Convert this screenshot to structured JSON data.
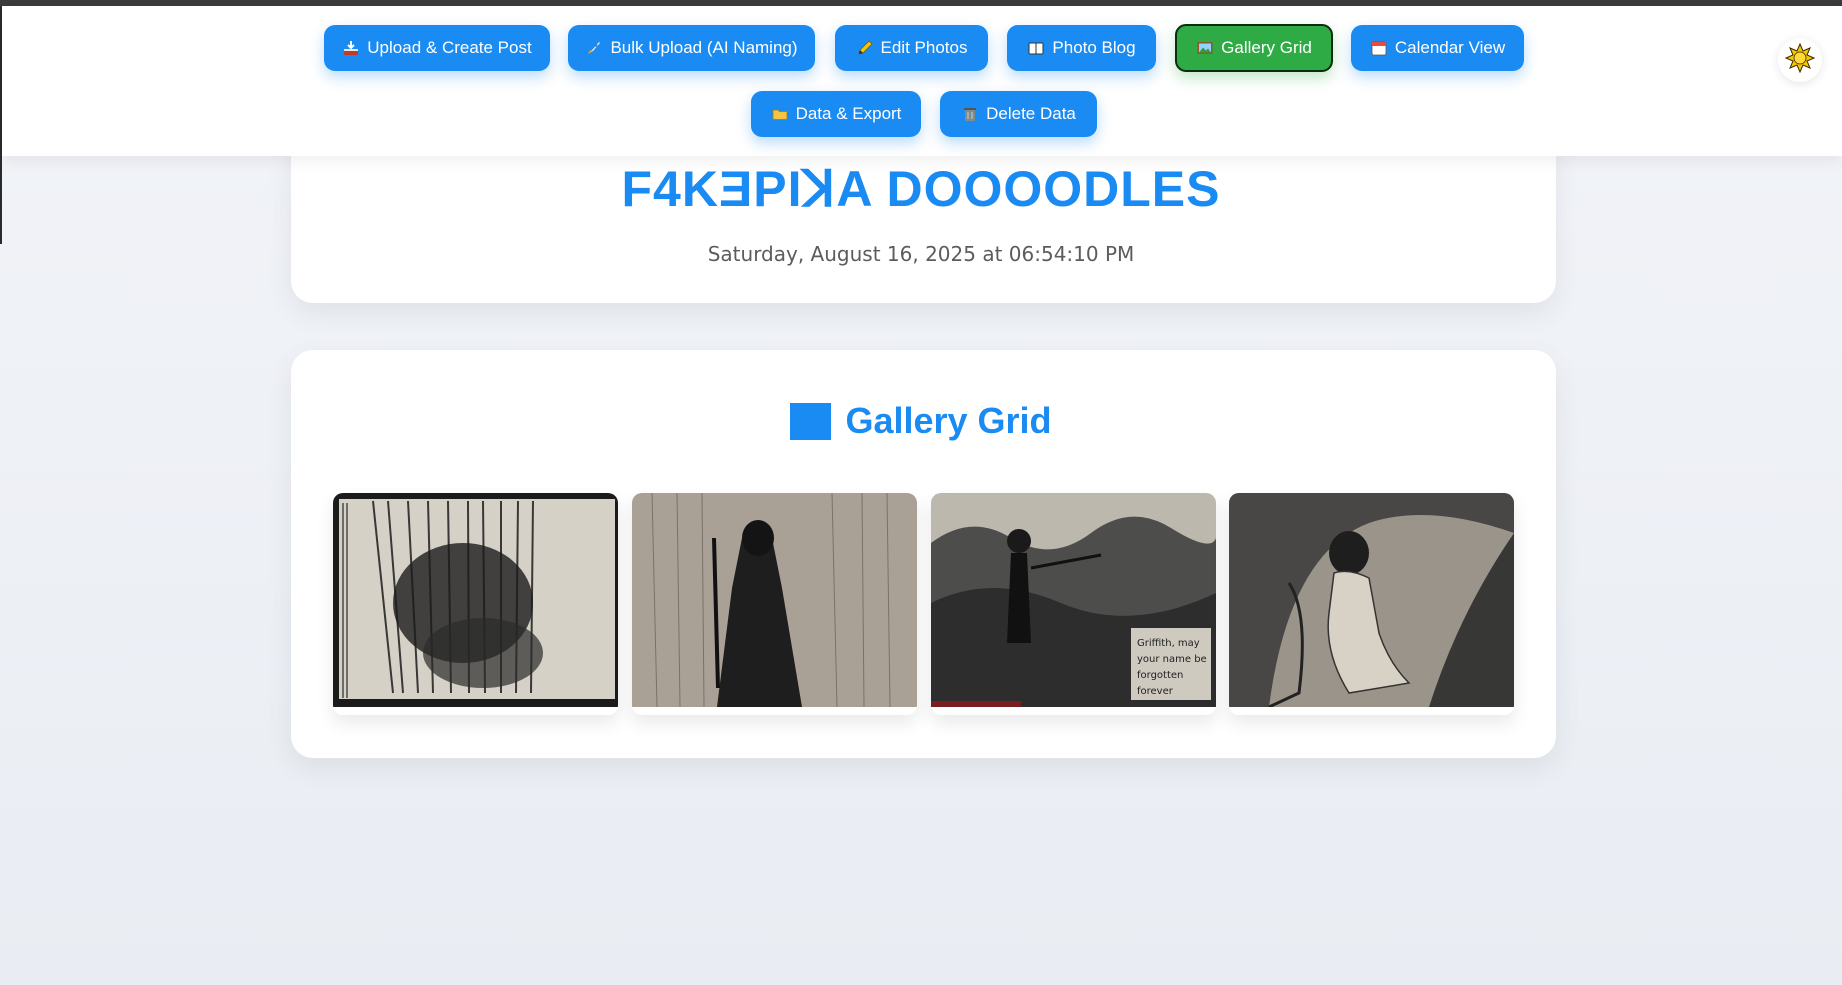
{
  "nav": {
    "buttons": [
      {
        "label": "Upload & Create Post",
        "icon": "inbox-tray-icon"
      },
      {
        "label": "Bulk Upload (AI Naming)",
        "icon": "rocket-icon"
      },
      {
        "label": "Edit Photos",
        "icon": "pencil-icon"
      },
      {
        "label": "Photo Blog",
        "icon": "book-icon"
      },
      {
        "label": "Gallery Grid",
        "icon": "framed-picture-icon",
        "active": true
      },
      {
        "label": "Calendar View",
        "icon": "calendar-icon"
      },
      {
        "label": "Data & Export",
        "icon": "folder-icon"
      },
      {
        "label": "Delete Data",
        "icon": "trash-icon"
      }
    ],
    "theme_toggle_icon": "sun-icon"
  },
  "header": {
    "title": "F4KƎPIꓘA DOOOODLES",
    "timestamp": "Saturday, August 16, 2025 at 06:54:10 PM"
  },
  "gallery": {
    "heading": "Gallery Grid",
    "heading_icon": "blue-square-icon",
    "images": [
      {
        "caption": "",
        "alt_text": ""
      },
      {
        "caption": "",
        "alt_text": ""
      },
      {
        "caption": "Griffith, may your name be forgotten forever",
        "alt_text": ""
      },
      {
        "caption": "",
        "alt_text": ""
      }
    ]
  },
  "colors": {
    "accent": "#1a8bf2",
    "active": "#2eab45",
    "background": "#eef1f6"
  }
}
